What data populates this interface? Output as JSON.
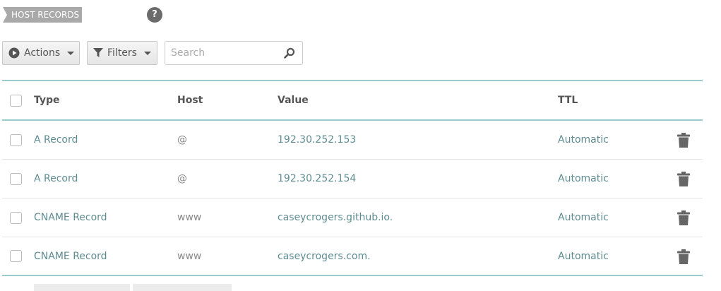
{
  "section": {
    "title": "HOST RECORDS",
    "help": "?"
  },
  "toolbar": {
    "actions_label": "Actions",
    "filters_label": "Filters",
    "search_placeholder": "Search"
  },
  "table": {
    "columns": {
      "type": "Type",
      "host": "Host",
      "value": "Value",
      "ttl": "TTL"
    },
    "rows": [
      {
        "type": "A Record",
        "host": "@",
        "value": "192.30.252.153",
        "ttl": "Automatic"
      },
      {
        "type": "A Record",
        "host": "@",
        "value": "192.30.252.154",
        "ttl": "Automatic"
      },
      {
        "type": "CNAME Record",
        "host": "www",
        "value": "caseycrogers.github.io.",
        "ttl": "Automatic"
      },
      {
        "type": "CNAME Record",
        "host": "www",
        "value": "caseycrogers.com.",
        "ttl": "Automatic"
      }
    ]
  },
  "icons": {
    "actions": "play-circle-icon",
    "filters": "funnel-icon",
    "search": "magnifier-icon",
    "delete": "trash-icon"
  },
  "colors": {
    "accent_line": "#98c9cc",
    "link_text": "#5e8c91",
    "tag_bg": "#a9a9a9",
    "icon_dark": "#6b6b6b"
  }
}
